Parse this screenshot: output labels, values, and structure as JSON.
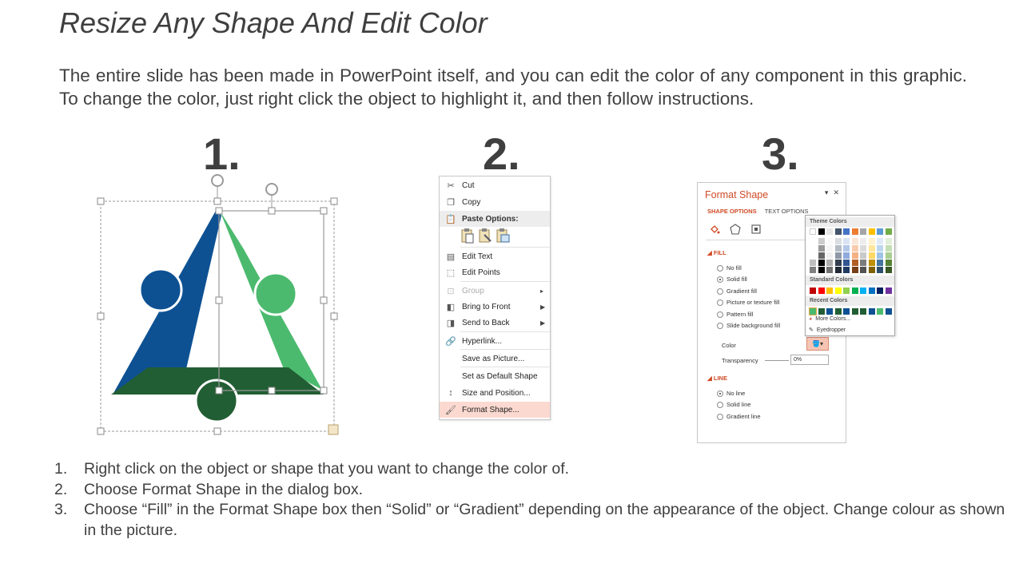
{
  "title": "Resize Any Shape And Edit Color",
  "intro": "The entire slide has been made in PowerPoint itself, and you can edit the color of any component in this graphic. To change the color, just right click the object to highlight it, and then follow instructions.",
  "step_numbers": [
    "1.",
    "2.",
    "3."
  ],
  "colors": {
    "blue": "#0d5193",
    "green": "#4cba6e",
    "dark_green": "#225e34",
    "menu_highlight": "#fbd9d0",
    "pane_accent": "#d04a25"
  },
  "context_menu": {
    "items": [
      {
        "label": "Cut",
        "icon": "scissors-icon"
      },
      {
        "label": "Copy",
        "icon": "copy-icon"
      },
      {
        "label": "Paste Options:",
        "icon": "clipboard-icon"
      },
      {
        "label": "Edit Text",
        "icon": "edit-text-icon"
      },
      {
        "label": "Edit Points",
        "icon": "edit-points-icon"
      },
      {
        "label": "Group",
        "icon": "group-icon"
      },
      {
        "label": "Bring to Front",
        "icon": "bring-to-front-icon"
      },
      {
        "label": "Send to Back",
        "icon": "send-to-back-icon"
      },
      {
        "label": "Hyperlink...",
        "icon": "hyperlink-icon"
      },
      {
        "label": "Save as Picture...",
        "icon": ""
      },
      {
        "label": "Set as Default Shape",
        "icon": ""
      },
      {
        "label": "Size and Position...",
        "icon": "size-position-icon"
      },
      {
        "label": "Format Shape...",
        "icon": "format-shape-icon"
      }
    ]
  },
  "format_pane": {
    "title": "Format Shape",
    "tab_shape": "SHAPE OPTIONS",
    "tab_text": "TEXT OPTIONS",
    "fill_header": "FILL",
    "fill_options": [
      "No fill",
      "Solid fill",
      "Gradient fill",
      "Picture or texture fill",
      "Pattern fill",
      "Slide background fill"
    ],
    "selected_fill": "Solid fill",
    "color_label": "Color",
    "transparency_label": "Transparency",
    "transparency_value": "0%",
    "line_header": "LINE",
    "line_options": [
      "No line",
      "Solid line",
      "Gradient line"
    ],
    "selected_line": "No line"
  },
  "palette": {
    "theme_label": "Theme Colors",
    "standard_label": "Standard Colors",
    "recent_label": "Recent Colors",
    "more_colors": "More Colors...",
    "eyedropper": "Eyedropper"
  },
  "instructions": [
    {
      "n": "1.",
      "text": "Right click on the object or shape that you want to change the color of."
    },
    {
      "n": "2.",
      "text": "Choose Format Shape in the dialog box."
    },
    {
      "n": "3.",
      "text": "Choose “Fill” in the Format Shape box then “Solid” or “Gradient” depending on the appearance of the object. Change colour as shown in the picture."
    }
  ]
}
